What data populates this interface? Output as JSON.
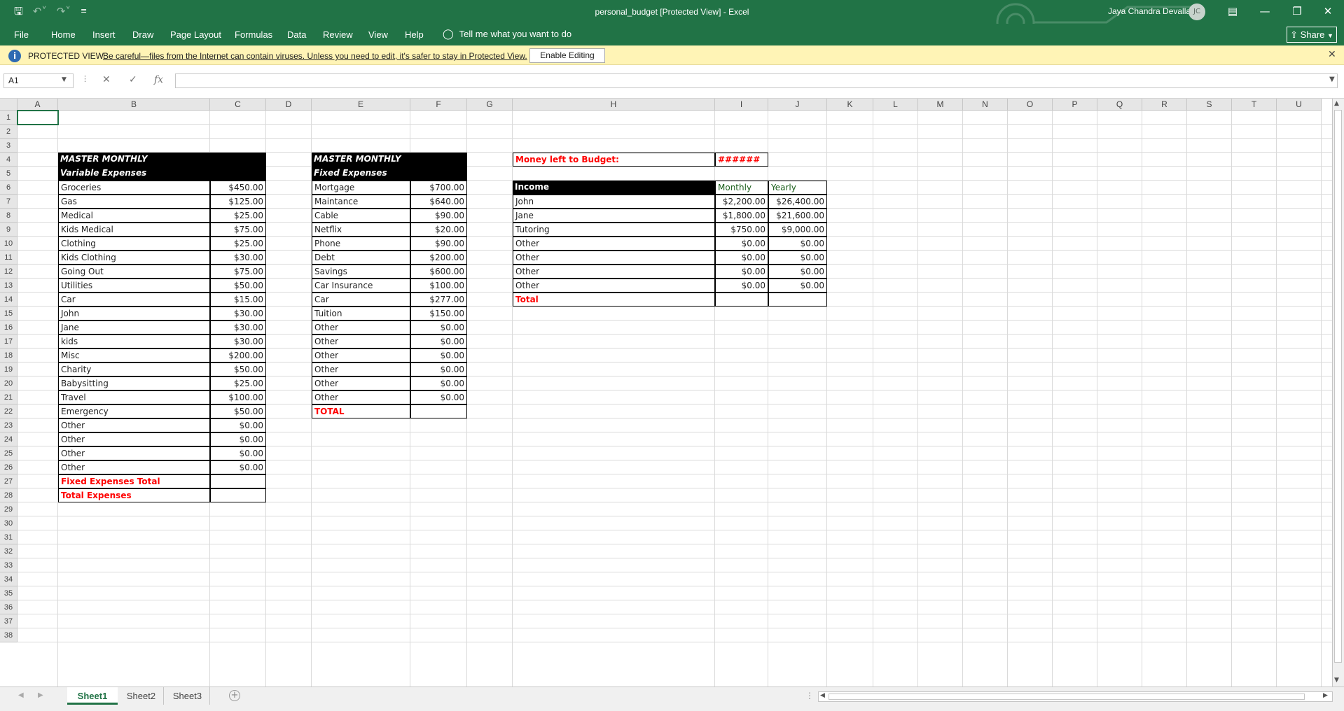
{
  "app": {
    "title": "personal_budget  [Protected View]  -  Excel",
    "user": "Jaya Chandra Devalla",
    "user_initials": "JC",
    "accent": "#217346"
  },
  "ribbon": {
    "tabs": [
      "File",
      "Home",
      "Insert",
      "Draw",
      "Page Layout",
      "Formulas",
      "Data",
      "Review",
      "View",
      "Help"
    ],
    "tell_me": "Tell me what you want to do",
    "share": "Share"
  },
  "protected": {
    "title": "PROTECTED VIEW",
    "message": "Be careful—files from the Internet can contain viruses. Unless you need to edit, it's safer to stay in Protected View.",
    "enable": "Enable Editing"
  },
  "formula": {
    "name_box": "A1",
    "fx": "fx",
    "value": ""
  },
  "columns": [
    "A",
    "B",
    "C",
    "D",
    "E",
    "F",
    "G",
    "H",
    "I",
    "J",
    "K",
    "L",
    "M",
    "N",
    "O",
    "P",
    "Q",
    "R",
    "S",
    "T",
    "U"
  ],
  "rows": 38,
  "variable": {
    "heading1": "MASTER MONTHLY",
    "heading2": "Variable Expenses",
    "items": [
      {
        "label": "Groceries",
        "amount": "$450.00"
      },
      {
        "label": "Gas",
        "amount": "$125.00"
      },
      {
        "label": "Medical",
        "amount": "$25.00"
      },
      {
        "label": "Kids Medical",
        "amount": "$75.00"
      },
      {
        "label": "Clothing",
        "amount": "$25.00"
      },
      {
        "label": "Kids Clothing",
        "amount": "$30.00"
      },
      {
        "label": "Going Out",
        "amount": "$75.00"
      },
      {
        "label": "Utilities",
        "amount": "$50.00"
      },
      {
        "label": "Car",
        "amount": "$15.00"
      },
      {
        "label": "John",
        "amount": "$30.00"
      },
      {
        "label": "Jane",
        "amount": "$30.00"
      },
      {
        "label": "kids",
        "amount": "$30.00"
      },
      {
        "label": "Misc",
        "amount": "$200.00"
      },
      {
        "label": "Charity",
        "amount": "$50.00"
      },
      {
        "label": "Babysitting",
        "amount": "$25.00"
      },
      {
        "label": "Travel",
        "amount": "$100.00"
      },
      {
        "label": "Emergency",
        "amount": "$50.00"
      },
      {
        "label": "Other",
        "amount": "$0.00"
      },
      {
        "label": "Other",
        "amount": "$0.00"
      },
      {
        "label": "Other",
        "amount": "$0.00"
      },
      {
        "label": "Other",
        "amount": "$0.00"
      }
    ],
    "fixed_total_label": "Fixed Expenses Total",
    "total_label": "Total Expenses"
  },
  "fixed": {
    "heading1": "MASTER MONTHLY",
    "heading2": "Fixed Expenses",
    "items": [
      {
        "label": "Mortgage",
        "amount": "$700.00"
      },
      {
        "label": "Maintance",
        "amount": "$640.00"
      },
      {
        "label": "Cable",
        "amount": "$90.00"
      },
      {
        "label": "Netflix",
        "amount": "$20.00"
      },
      {
        "label": "Phone",
        "amount": "$90.00"
      },
      {
        "label": "Debt",
        "amount": "$200.00"
      },
      {
        "label": "Savings",
        "amount": "$600.00"
      },
      {
        "label": "Car Insurance",
        "amount": "$100.00"
      },
      {
        "label": "Car",
        "amount": "$277.00"
      },
      {
        "label": "Tuition",
        "amount": "$150.00"
      },
      {
        "label": "Other",
        "amount": "$0.00"
      },
      {
        "label": "Other",
        "amount": "$0.00"
      },
      {
        "label": "Other",
        "amount": "$0.00"
      },
      {
        "label": "Other",
        "amount": "$0.00"
      },
      {
        "label": "Other",
        "amount": "$0.00"
      },
      {
        "label": "Other",
        "amount": "$0.00"
      }
    ],
    "total_label": "TOTAL"
  },
  "budget": {
    "money_left_label": "Money left to Budget:",
    "money_left_value": "######"
  },
  "income": {
    "header": "Income",
    "monthly": "Monthly",
    "yearly": "Yearly",
    "rows": [
      {
        "label": "John",
        "monthly": "$2,200.00",
        "yearly": "$26,400.00"
      },
      {
        "label": "Jane",
        "monthly": "$1,800.00",
        "yearly": "$21,600.00"
      },
      {
        "label": "Tutoring",
        "monthly": "$750.00",
        "yearly": "$9,000.00"
      },
      {
        "label": "Other",
        "monthly": "$0.00",
        "yearly": "$0.00"
      },
      {
        "label": "Other",
        "monthly": "$0.00",
        "yearly": "$0.00"
      },
      {
        "label": "Other",
        "monthly": "$0.00",
        "yearly": "$0.00"
      },
      {
        "label": "Other",
        "monthly": "$0.00",
        "yearly": "$0.00"
      }
    ],
    "total_label": "Total"
  },
  "sheets": [
    "Sheet1",
    "Sheet2",
    "Sheet3"
  ]
}
